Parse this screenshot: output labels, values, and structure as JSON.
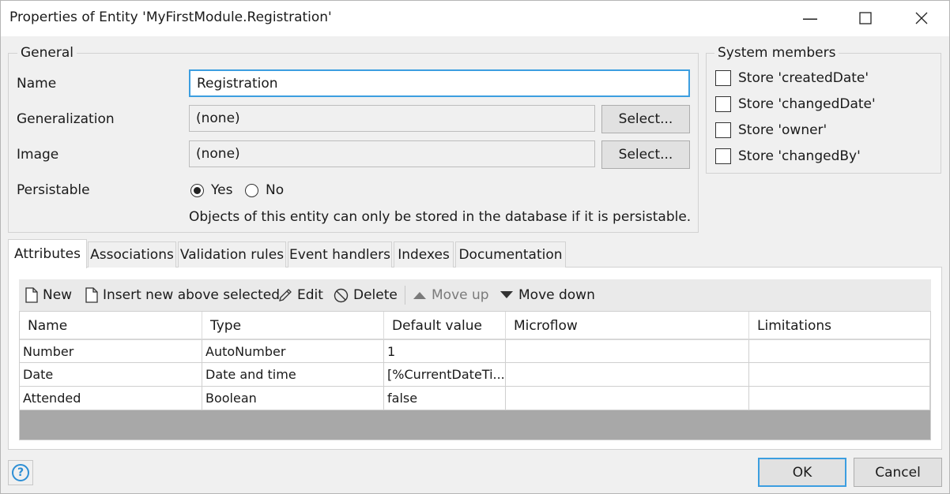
{
  "window": {
    "title": "Properties of Entity 'MyFirstModule.Registration'",
    "controls": {
      "minimize": "—",
      "maximize": "☐",
      "close": "✕"
    }
  },
  "general": {
    "legend": "General",
    "name_label": "Name",
    "name_value": "Registration",
    "generalization_label": "Generalization",
    "generalization_value": "(none)",
    "generalization_button": "Select...",
    "image_label": "Image",
    "image_value": "(none)",
    "image_button": "Select...",
    "persistable_label": "Persistable",
    "persistable_options": [
      {
        "label": "Yes",
        "selected": true
      },
      {
        "label": "No",
        "selected": false
      }
    ],
    "persistable_note": "Objects of this entity can only be stored in the database if it is persistable."
  },
  "system_members": {
    "legend": "System members",
    "items": [
      {
        "label": "Store 'createdDate'",
        "checked": false
      },
      {
        "label": "Store 'changedDate'",
        "checked": false
      },
      {
        "label": "Store 'owner'",
        "checked": false
      },
      {
        "label": "Store 'changedBy'",
        "checked": false
      }
    ]
  },
  "tabs": [
    {
      "label": "Attributes",
      "selected": true
    },
    {
      "label": "Associations",
      "selected": false
    },
    {
      "label": "Validation rules",
      "selected": false
    },
    {
      "label": "Event handlers",
      "selected": false
    },
    {
      "label": "Indexes",
      "selected": false
    },
    {
      "label": "Documentation",
      "selected": false
    }
  ],
  "toolbar": {
    "new": "New",
    "insert": "Insert new above selected",
    "edit": "Edit",
    "delete": "Delete",
    "move_up": "Move up",
    "move_down": "Move down"
  },
  "attributes_table": {
    "columns": [
      "Name",
      "Type",
      "Default value",
      "Microflow",
      "Limitations"
    ],
    "rows": [
      [
        "Number",
        "AutoNumber",
        "1",
        "",
        ""
      ],
      [
        "Date",
        "Date and time",
        "[%CurrentDateTi...",
        "",
        ""
      ],
      [
        "Attended",
        "Boolean",
        "false",
        "",
        ""
      ]
    ]
  },
  "footer": {
    "help_glyph": "?",
    "ok": "OK",
    "cancel": "Cancel"
  },
  "colors": {
    "focus_border": "#3c9ee0",
    "grid_empty": "#a8a8a8",
    "help_icon": "#2d8fd5"
  }
}
